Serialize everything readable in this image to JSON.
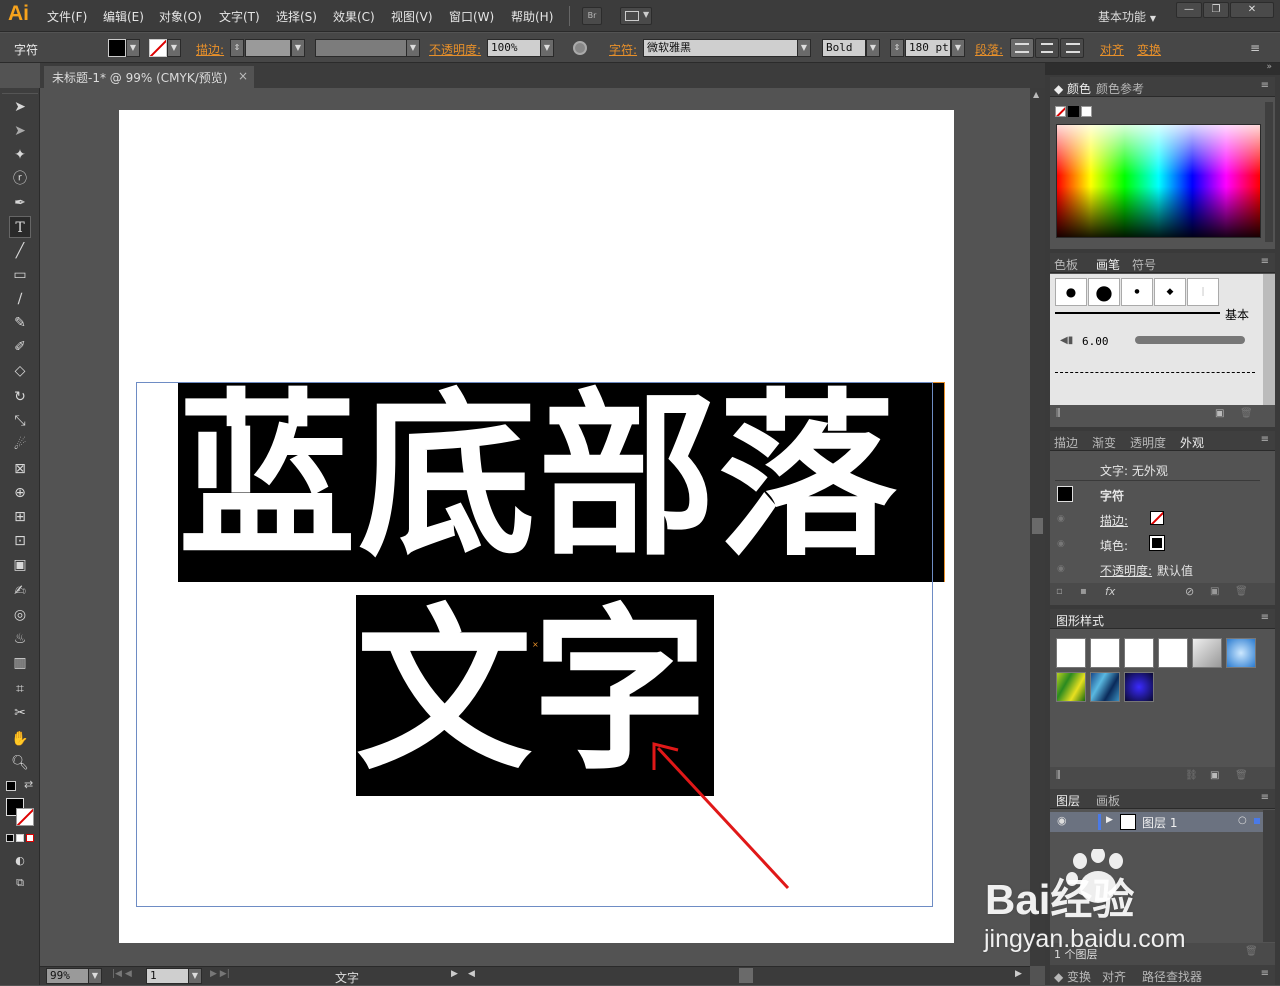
{
  "app": {
    "logo": "Ai"
  },
  "menu": [
    {
      "label": "文件(F)"
    },
    {
      "label": "编辑(E)"
    },
    {
      "label": "对象(O)"
    },
    {
      "label": "文字(T)"
    },
    {
      "label": "选择(S)"
    },
    {
      "label": "效果(C)"
    },
    {
      "label": "视图(V)"
    },
    {
      "label": "窗口(W)"
    },
    {
      "label": "帮助(H)"
    }
  ],
  "menubar_icons": {
    "bridge": "Br",
    "arrange": "arrange-documents-icon"
  },
  "workspace": {
    "label": "基本功能"
  },
  "window_controls": {
    "minimize": "—",
    "restore": "❐",
    "close": "✕"
  },
  "control_bar": {
    "panel_label": "字符",
    "stroke_label": "描边:",
    "opacity_label": "不透明度:",
    "opacity_value": "100%",
    "character_label": "字符:",
    "font_family": "微软雅黑",
    "font_style": "Bold",
    "font_size": "180 pt",
    "paragraph_label": "段落:",
    "align_label": "对齐",
    "transform_label": "变换"
  },
  "document": {
    "tab_title": "未标题-1* @ 99% (CMYK/预览)",
    "tab_close": "×",
    "line1": "蓝底部落",
    "line2": "文字"
  },
  "status": {
    "zoom": "99%",
    "page": "1",
    "tool_name": "文字"
  },
  "panels": {
    "color": {
      "tabs": [
        "颜色",
        "颜色参考"
      ]
    },
    "brushes": {
      "tabs": [
        "色板",
        "画笔",
        "符号"
      ],
      "basic_label": "基本",
      "size_value": "6.00"
    },
    "appearance": {
      "tabs": [
        "描边",
        "渐变",
        "透明度",
        "外观"
      ],
      "title": "文字: 无外观",
      "group": "字符",
      "stroke_label": "描边:",
      "fill_label": "填色:",
      "opacity_label": "不透明度:",
      "opacity_value": "默认值"
    },
    "graphic_styles": {
      "tabs": [
        "图形样式"
      ]
    },
    "layers": {
      "tabs": [
        "图层",
        "画板"
      ],
      "layer_name": "图层 1",
      "layer_count": "1 个图层"
    },
    "bottom": {
      "tabs": [
        "变换",
        "对齐",
        "路径查找器"
      ]
    }
  },
  "watermark": {
    "brand": "Bai经验",
    "url": "jingyan.baidu.com"
  },
  "colors": {
    "accent_orange": "#e8902a",
    "logo_orange": "#f7a31c",
    "arrow_red": "#e01818",
    "selection_blue": "#6e8cc4"
  }
}
